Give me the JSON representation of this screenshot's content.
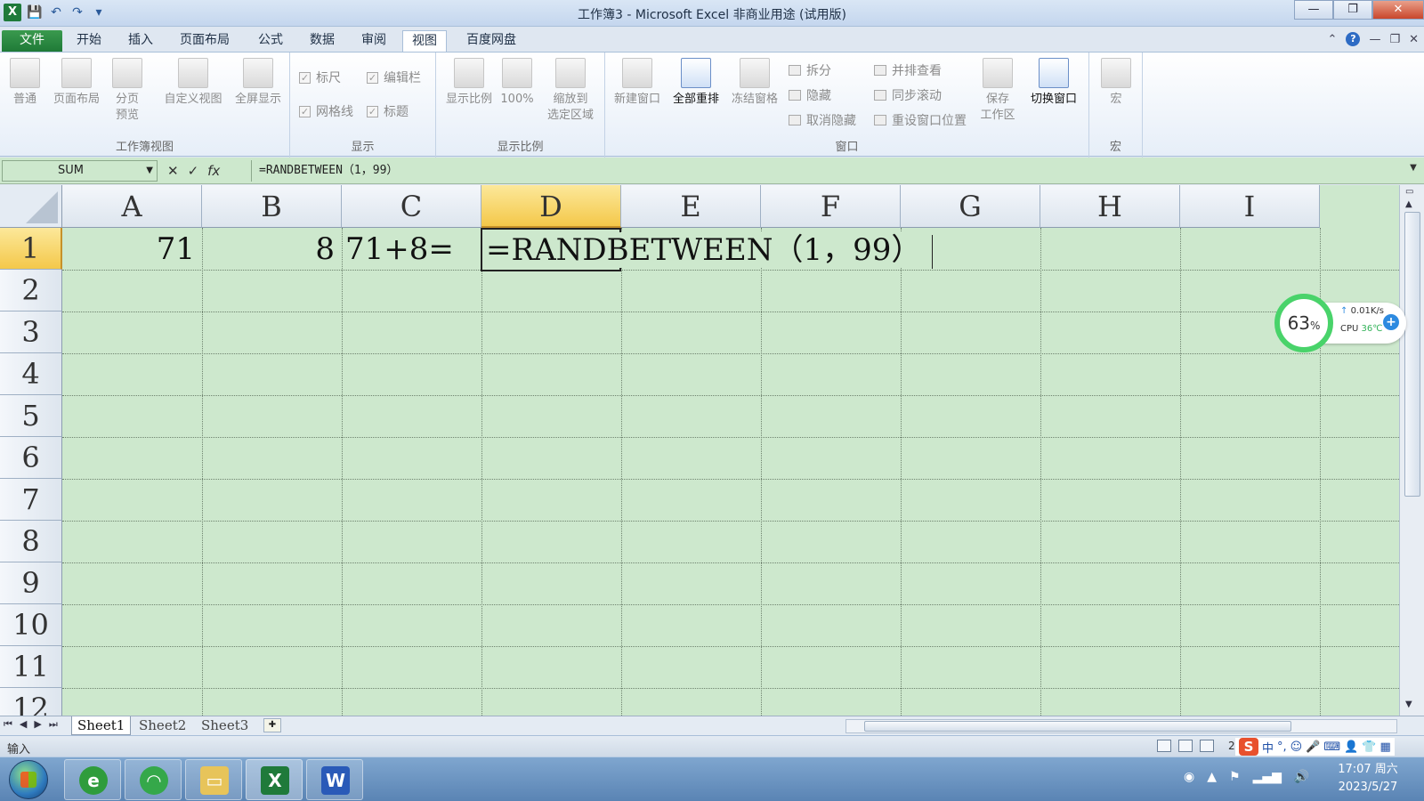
{
  "window": {
    "title": "工作簿3 - Microsoft Excel 非商业用途 (试用版)",
    "minimize": "—",
    "restore": "❐",
    "close": "✕"
  },
  "qat": {
    "app_icon": "X"
  },
  "tabs": [
    {
      "label": "文件"
    },
    {
      "label": "开始"
    },
    {
      "label": "插入"
    },
    {
      "label": "页面布局"
    },
    {
      "label": "公式"
    },
    {
      "label": "数据"
    },
    {
      "label": "审阅"
    },
    {
      "label": "视图"
    },
    {
      "label": "百度网盘"
    }
  ],
  "ribbon": {
    "workbook_views": {
      "label": "工作簿视图",
      "normal": "普通",
      "page_layout": "页面布局",
      "page_break_1": "分页",
      "page_break_2": "预览",
      "custom_views": "自定义视图",
      "full_screen": "全屏显示"
    },
    "show": {
      "label": "显示",
      "ruler": "标尺",
      "formula_bar": "编辑栏",
      "gridlines": "网格线",
      "headings": "标题"
    },
    "zoom": {
      "label": "显示比例",
      "zoom": "显示比例",
      "hundred": "100%",
      "to_selection_1": "缩放到",
      "to_selection_2": "选定区域"
    },
    "window": {
      "label": "窗口",
      "new_window": "新建窗口",
      "arrange_all": "全部重排",
      "freeze_panes": "冻结窗格",
      "split": "拆分",
      "hide": "隐藏",
      "unhide": "取消隐藏",
      "side_by_side": "并排查看",
      "sync_scroll": "同步滚动",
      "reset_position": "重设窗口位置",
      "save_ws_1": "保存",
      "save_ws_2": "工作区",
      "switch_windows": "切换窗口"
    },
    "macros": {
      "label": "宏",
      "macros": "宏"
    }
  },
  "formula_bar": {
    "name_box": "SUM",
    "fx": "fx",
    "formula": "=RANDBETWEEN（1，99）"
  },
  "sheet": {
    "columns": [
      "A",
      "B",
      "C",
      "D",
      "E",
      "F",
      "G",
      "H",
      "I"
    ],
    "rows": [
      "1",
      "2",
      "3",
      "4",
      "5",
      "6",
      "7",
      "8",
      "9",
      "10",
      "11",
      "12"
    ],
    "cells": {
      "A1": "71",
      "B1": "8",
      "C1": "71+8=",
      "D1": "=RANDBETWEEN（1，99）"
    }
  },
  "monitor": {
    "percent": "63",
    "percent_sign": "%",
    "net": "0.01K/s",
    "cpu_label": "CPU",
    "cpu_temp": "36℃"
  },
  "sheet_tabs": [
    "Sheet1",
    "Sheet2",
    "Sheet3"
  ],
  "status": {
    "mode": "输入",
    "zoom_partial": "2",
    "ime": "中"
  },
  "taskbar": {
    "time": "17:07 周六",
    "date": "2023/5/27"
  },
  "colors": {
    "sheet_bg": "#cde8cd",
    "selected_header": "#f4c84a",
    "file_tab": "#1f7a37",
    "monitor_ring": "#49d36a"
  }
}
